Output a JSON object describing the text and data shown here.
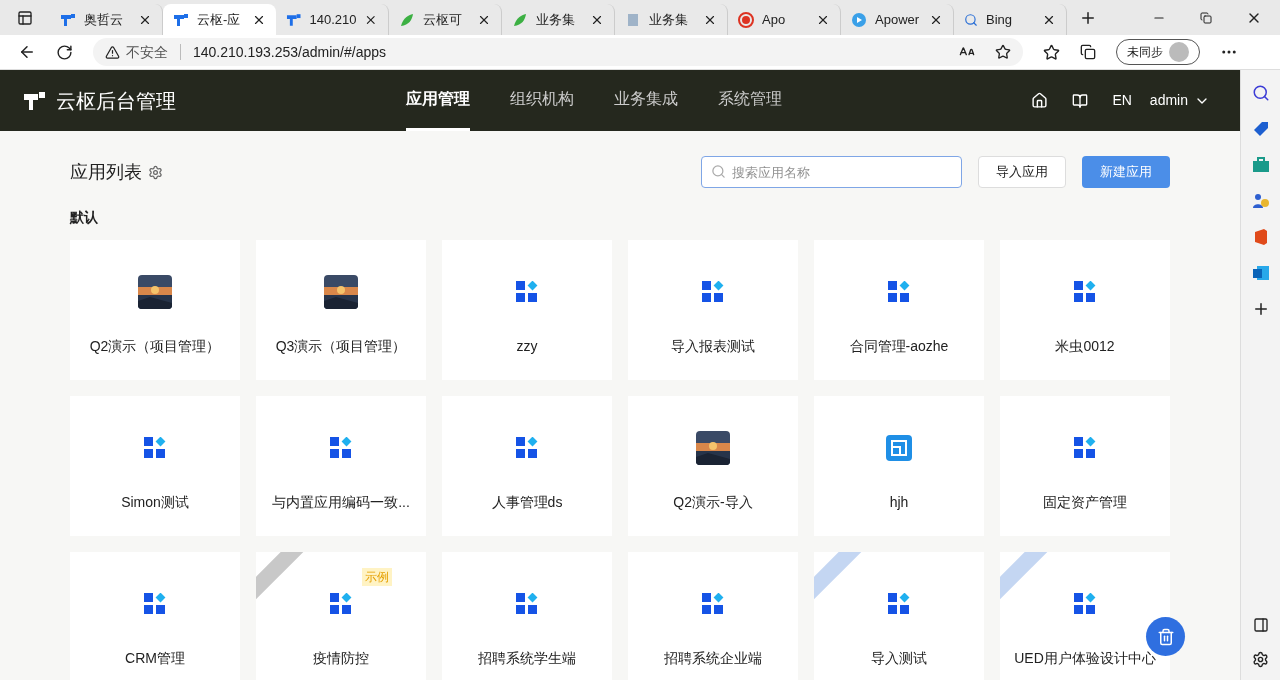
{
  "browser": {
    "tabs": [
      {
        "label": "奥哲云",
        "selected": false,
        "kind": "logo"
      },
      {
        "label": "云枢-应",
        "selected": true,
        "kind": "logo"
      },
      {
        "label": "140.210",
        "selected": false,
        "kind": "logo"
      },
      {
        "label": "云枢可",
        "selected": false,
        "kind": "leaf"
      },
      {
        "label": "业务集",
        "selected": false,
        "kind": "leaf"
      },
      {
        "label": "业务集",
        "selected": false,
        "kind": "page"
      },
      {
        "label": "Apo",
        "selected": false,
        "kind": "record"
      },
      {
        "label": "Apower",
        "selected": false,
        "kind": "play"
      },
      {
        "label": "Bing",
        "selected": false,
        "kind": "search"
      }
    ],
    "security": "不安全",
    "url": "140.210.193.253/admin/#/apps",
    "profile": "未同步"
  },
  "header": {
    "title": "云枢后台管理",
    "nav": [
      {
        "label": "应用管理",
        "selected": true
      },
      {
        "label": "组织机构",
        "selected": false
      },
      {
        "label": "业务集成",
        "selected": false
      },
      {
        "label": "系统管理",
        "selected": false
      }
    ],
    "lang": "EN",
    "user": "admin"
  },
  "page": {
    "title": "应用列表",
    "search": {
      "placeholder": "搜索应用名称"
    },
    "buttons": [
      {
        "label": "导入应用",
        "kind": "default"
      },
      {
        "label": "新建应用",
        "kind": "primary"
      }
    ],
    "group": "默认",
    "apps": [
      {
        "name": "Q2演示（项目管理）",
        "kind": "picture"
      },
      {
        "name": "Q3演示（项目管理）",
        "kind": "picture"
      },
      {
        "name": "zzy",
        "kind": "grid"
      },
      {
        "name": "导入报表测试",
        "kind": "grid"
      },
      {
        "name": "合同管理-aozhe",
        "kind": "grid"
      },
      {
        "name": "米虫0012",
        "kind": "grid"
      },
      {
        "name": "Simon测试",
        "kind": "grid"
      },
      {
        "name": "与内置应用编码一致...",
        "kind": "grid"
      },
      {
        "name": "人事管理ds",
        "kind": "grid"
      },
      {
        "name": "Q2演示-导入",
        "kind": "picture"
      },
      {
        "name": "hjh",
        "kind": "form"
      },
      {
        "name": "固定资产管理",
        "kind": "grid"
      },
      {
        "name": "CRM管理",
        "kind": "grid"
      },
      {
        "name": "疫情防控",
        "kind": "grid",
        "ribbon": {
          "color": "#c8c8c8"
        },
        "tag": "示例"
      },
      {
        "name": "招聘系统学生端",
        "kind": "grid"
      },
      {
        "name": "招聘系统企业端",
        "kind": "grid"
      },
      {
        "name": "导入测试",
        "kind": "grid",
        "ribbon": {
          "color": "#c4d6f2"
        }
      },
      {
        "name": "UED用户体验设计中心",
        "kind": "grid",
        "ribbon": {
          "color": "#c4d6f2"
        }
      }
    ]
  }
}
